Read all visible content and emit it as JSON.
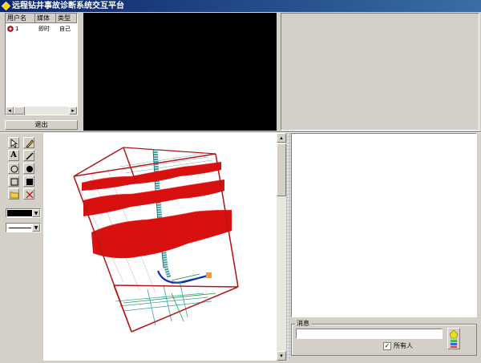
{
  "window": {
    "title": "远程钻井事故诊断系统交互平台"
  },
  "user_list": {
    "headers": [
      "用户名",
      "媒体",
      "类型"
    ],
    "rows": [
      {
        "name": "1",
        "media": "即时",
        "type": "自己"
      }
    ]
  },
  "logout_label": "退出",
  "tools": {
    "icons": [
      "select-arrow-icon",
      "pencil-icon",
      "text-icon",
      "line-icon",
      "circle-outline-icon",
      "circle-filled-icon",
      "rect-outline-icon",
      "rect-filled-icon",
      "open-folder-icon",
      "clear-icon"
    ],
    "color_swatch": "#000000"
  },
  "message": {
    "group_label": "消息",
    "input_value": "",
    "all_users_label": "所有人",
    "all_users_checked": true
  },
  "colors": {
    "titlebar": "#0a246a",
    "surface_red": "#d81010",
    "box_red": "#b01818",
    "drill_blue": "#1028c8",
    "mesh_teal": "#40a0a0"
  }
}
